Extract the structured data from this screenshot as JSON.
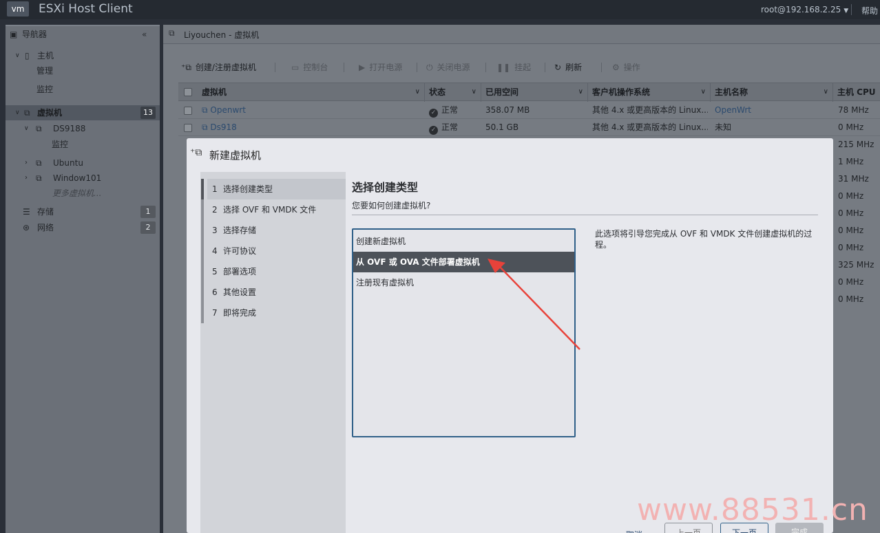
{
  "topbar": {
    "logo": "vm",
    "title": "ESXi Host Client",
    "user": "root@192.168.2.25",
    "help": "帮助"
  },
  "navigator": {
    "title": "导航器",
    "host": {
      "label": "主机",
      "children": [
        "管理",
        "监控"
      ]
    },
    "vm": {
      "label": "虚拟机",
      "count": "13",
      "items": [
        {
          "label": "DS9188",
          "child": "监控"
        },
        {
          "label": "Ubuntu"
        },
        {
          "label": "Window101"
        }
      ],
      "more": "更多虚拟机..."
    },
    "storage": {
      "label": "存储",
      "count": "1"
    },
    "network": {
      "label": "网络",
      "count": "2"
    }
  },
  "main": {
    "header": "Liyouchen - 虚拟机",
    "toolbar": {
      "create": "创建/注册虚拟机",
      "console": "控制台",
      "power_on": "打开电源",
      "power_off": "关闭电源",
      "suspend": "挂起",
      "refresh": "刷新",
      "actions": "操作"
    },
    "table": {
      "columns": [
        "虚拟机",
        "状态",
        "已用空间",
        "客户机操作系统",
        "主机名称",
        "主机 CPU"
      ],
      "rows": [
        {
          "name": "Openwrt",
          "status": "正常",
          "space": "358.07 MB",
          "os": "其他 4.x 或更高版本的 Linux...",
          "hostname": "OpenWrt",
          "cpu": "78 MHz"
        },
        {
          "name": "Ds918",
          "status": "正常",
          "space": "50.1 GB",
          "os": "其他 4.x 或更高版本的 Linux...",
          "hostname": "未知",
          "cpu": "0 MHz"
        }
      ],
      "extra_cpu": [
        "215 MHz",
        "1 MHz",
        "31 MHz",
        "0 MHz",
        "0 MHz",
        "0 MHz",
        "0 MHz",
        "325 MHz",
        "0 MHz",
        "0 MHz"
      ]
    }
  },
  "dialog": {
    "title": "新建虚拟机",
    "steps": [
      {
        "num": "1",
        "label": "选择创建类型"
      },
      {
        "num": "2",
        "label": "选择 OVF 和 VMDK 文件"
      },
      {
        "num": "3",
        "label": "选择存储"
      },
      {
        "num": "4",
        "label": "许可协议"
      },
      {
        "num": "5",
        "label": "部署选项"
      },
      {
        "num": "6",
        "label": "其他设置"
      },
      {
        "num": "7",
        "label": "即将完成"
      }
    ],
    "content_title": "选择创建类型",
    "content_subtitle": "您要如何创建虚拟机?",
    "options": [
      "创建新虚拟机",
      "从 OVF 或 OVA 文件部署虚拟机",
      "注册现有虚拟机"
    ],
    "selected_option": "从 OVF 或 OVA 文件部署虚拟机",
    "description": "此选项将引导您完成从 OVF 和 VMDK 文件创建虚拟机的过程。",
    "buttons": {
      "cancel": "取消",
      "back": "上一页",
      "next": "下一页",
      "finish": "完成"
    }
  },
  "watermark": "www.88531.cn",
  "colors": {
    "arrow": "#e8423a",
    "selection": "#4d5259",
    "list_border": "#2f5f88"
  }
}
